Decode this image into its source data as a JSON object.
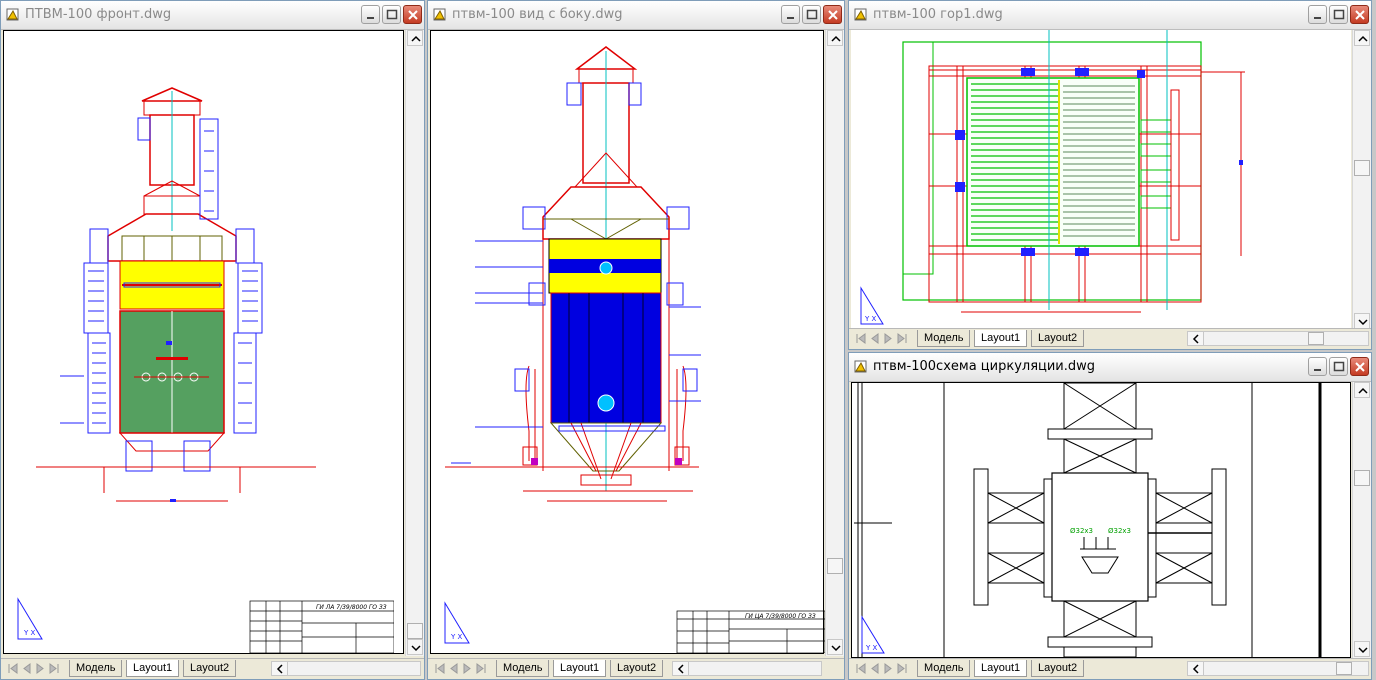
{
  "windows": [
    {
      "title": "ПТВМ-100 фронт.dwg",
      "tabs": [
        "Модель",
        "Layout1",
        "Layout2"
      ],
      "active_tab": "Layout1"
    },
    {
      "title": "птвм-100 вид с боку.dwg",
      "tabs": [
        "Модель",
        "Layout1",
        "Layout2"
      ],
      "active_tab": "Layout1"
    },
    {
      "title": "птвм-100 гор1.dwg",
      "tabs": [
        "Модель",
        "Layout1",
        "Layout2"
      ],
      "active_tab": "Layout1"
    },
    {
      "title": "птвм-100схема циркуляции.dwg",
      "tabs": [
        "Модель",
        "Layout1",
        "Layout2"
      ],
      "active_tab": "Layout1"
    }
  ],
  "drawings": {
    "front_stamp_code": "ГИ ЛА 7/39/8000 ГО ЗЗ",
    "side_stamp_code": "ГИ ЦА 7/39/8000 ГО ЗЗ",
    "circ_label_left": "Ø32х3",
    "circ_label_right": "Ø32х3"
  },
  "colors": {
    "drawing_red": "#e00000",
    "drawing_blue": "#2020ff",
    "drawing_green": "#00c000",
    "fill_green": "#55a060",
    "fill_yellow": "#ffff00",
    "fill_blue": "#0000e0",
    "close_button": "#c43b22"
  }
}
